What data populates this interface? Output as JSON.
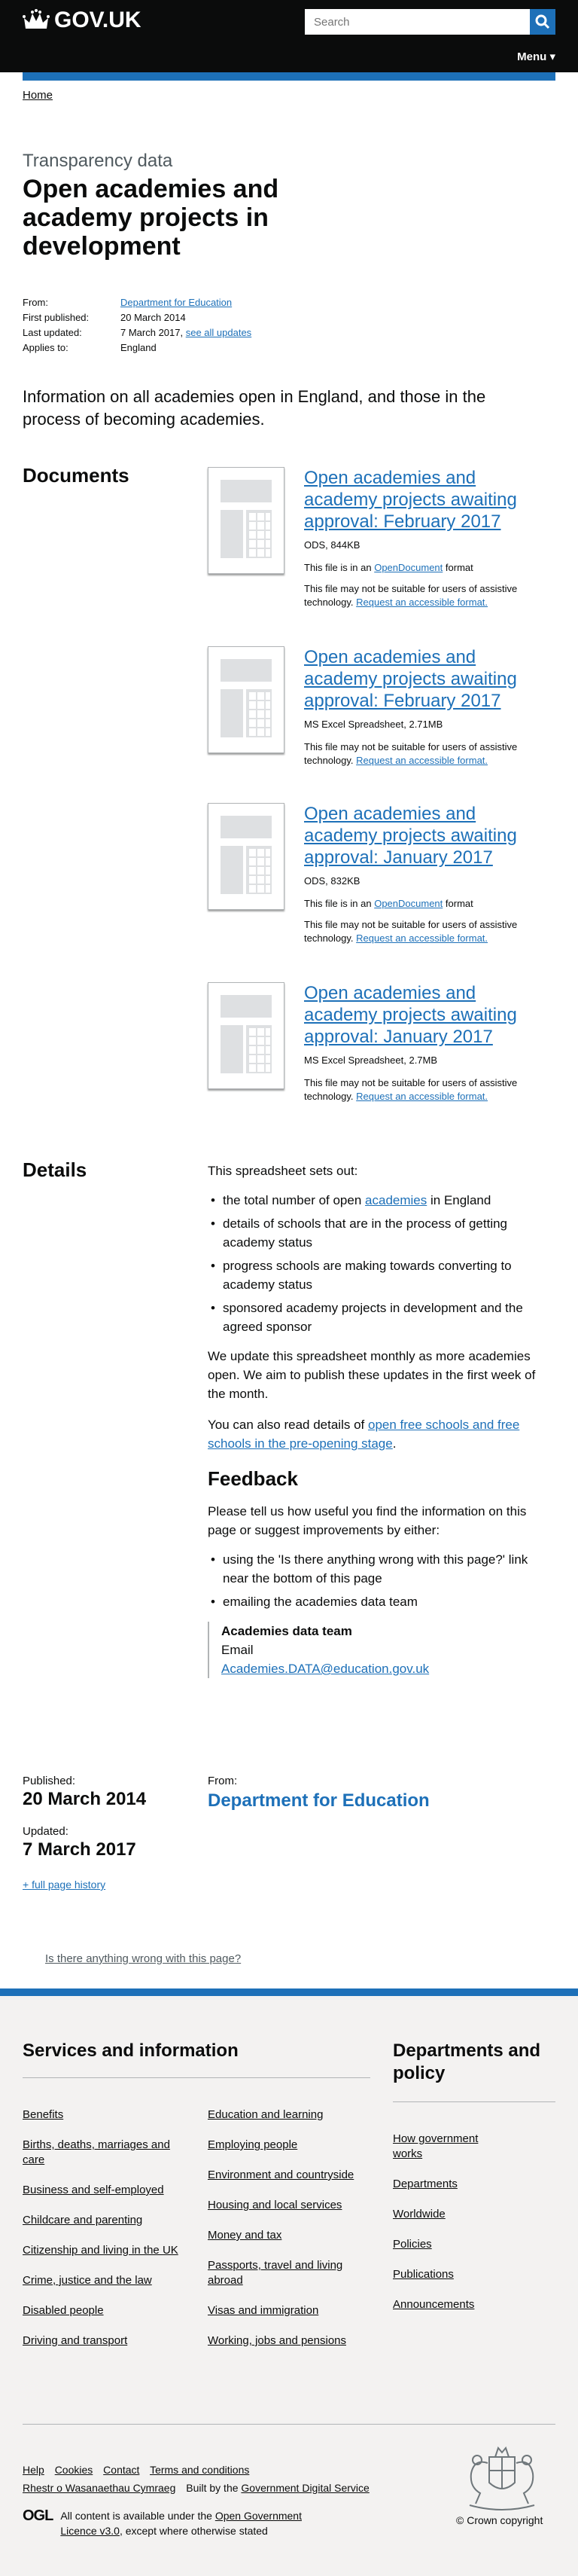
{
  "header": {
    "logo_text": "GOV.UK",
    "search_placeholder": "Search",
    "menu_label": "Menu ▾"
  },
  "breadcrumb": {
    "home": "Home"
  },
  "page": {
    "kicker": "Transparency data",
    "title": "Open academies and academy projects in development",
    "meta": {
      "from_label": "From:",
      "from_value": "Department for Education",
      "first_published_label": "First published:",
      "first_published_value": "20 March 2014",
      "last_updated_label": "Last updated:",
      "last_updated_value": "7 March 2017,",
      "see_all_updates": "see all updates",
      "applies_label": "Applies to:",
      "applies_value": "England"
    },
    "lead": "Information on all academies open in England, and those in the process of becoming academies."
  },
  "documents": {
    "heading": "Documents",
    "items": [
      {
        "title": "Open academies and academy projects awaiting approval: February 2017",
        "meta": "ODS, 844KB",
        "format_prefix": "This file is in an",
        "format_link": "OpenDocument",
        "format_suffix": "format",
        "access_note": "This file may not be suitable for users of assistive technology.",
        "access_link": "Request an accessible format."
      },
      {
        "title": "Open academies and academy projects awaiting approval: February 2017",
        "meta": "MS Excel Spreadsheet, 2.71MB",
        "access_note": "This file may not be suitable for users of assistive technology.",
        "access_link": "Request an accessible format."
      },
      {
        "title": "Open academies and academy projects awaiting approval: January 2017",
        "meta": "ODS, 832KB",
        "format_prefix": "This file is in an",
        "format_link": "OpenDocument",
        "format_suffix": "format",
        "access_note": "This file may not be suitable for users of assistive technology.",
        "access_link": "Request an accessible format."
      },
      {
        "title": "Open academies and academy projects awaiting approval: January 2017",
        "meta": "MS Excel Spreadsheet, 2.7MB",
        "access_note": "This file may not be suitable for users of assistive technology.",
        "access_link": "Request an accessible format."
      }
    ]
  },
  "details": {
    "heading": "Details",
    "intro": "This spreadsheet sets out:",
    "bullet1_prefix": "the total number of open",
    "bullet1_link": "academies",
    "bullet1_suffix": "in England",
    "bullet2": "details of schools that are in the process of getting academy status",
    "bullet3": "progress schools are making towards converting to academy status",
    "bullet4": "sponsored academy projects in development and the agreed sponsor",
    "update_para": "We update this spreadsheet monthly as more academies open. We aim to publish these updates in the first week of the month.",
    "also_prefix": "You can also read details of",
    "also_link": "open free schools and free schools in the pre-opening stage",
    "also_suffix": ".",
    "feedback_heading": "Feedback",
    "feedback_intro": "Please tell us how useful you find the information on this page or suggest improvements by either:",
    "fb_bullet1": "using the 'Is there anything wrong with this page?' link near the bottom of this page",
    "fb_bullet2": "emailing the academies data team",
    "contact_name": "Academies data team",
    "contact_email_label": "Email",
    "contact_email": "Academies.DATA@education.gov.uk"
  },
  "publication": {
    "published_label": "Published:",
    "published_value": "20 March 2014",
    "updated_label": "Updated:",
    "updated_value": "7 March 2017",
    "history_link": "+ full page history",
    "from_label": "From:",
    "from_value": "Department for Education"
  },
  "report_link": "Is there anything wrong with this page?",
  "footer": {
    "services_heading": "Services and information",
    "services_col1": [
      "Benefits",
      "Births, deaths, marriages and care",
      "Business and self-employed",
      "Childcare and parenting",
      "Citizenship and living in the UK",
      "Crime, justice and the law",
      "Disabled people",
      "Driving and transport"
    ],
    "services_col2": [
      "Education and learning",
      "Employing people",
      "Environment and countryside",
      "Housing and local services",
      "Money and tax",
      "Passports, travel and living abroad",
      "Visas and immigration",
      "Working, jobs and pensions"
    ],
    "departments_heading": "Departments and policy",
    "departments": [
      "How government works",
      "Departments",
      "Worldwide",
      "Policies",
      "Publications",
      "Announcements"
    ],
    "meta_links": [
      "Help",
      "Cookies",
      "Contact",
      "Terms and conditions"
    ],
    "welsh_link": "Rhestr o Wasanaethau Cymraeg",
    "built_by_prefix": "Built by the",
    "built_by_link": "Government Digital Service",
    "ogl_logo": "OGL",
    "licence_prefix": "All content is available under the",
    "licence_link": "Open Government Licence v3.0",
    "licence_suffix": ", except where otherwise stated",
    "copyright": "© Crown copyright"
  },
  "colors": {
    "brand_blue": "#1d70b8",
    "header_black": "#0b0c0c",
    "footer_grey": "#f3f2f1"
  }
}
